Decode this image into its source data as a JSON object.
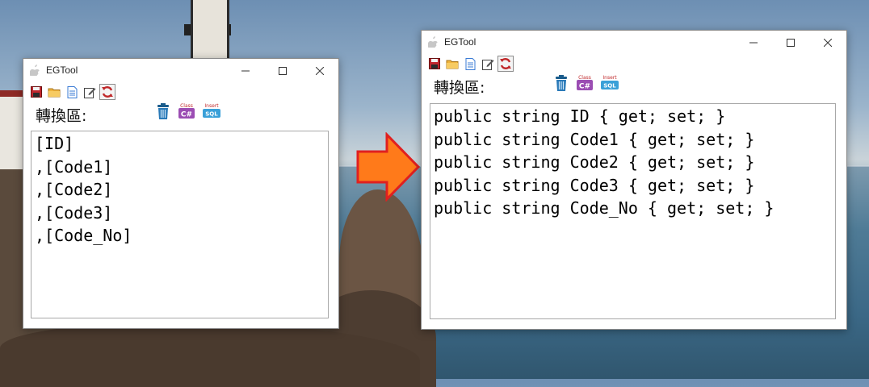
{
  "colors": {
    "arrow_fill": "#ff7a1a",
    "arrow_stroke": "#e02020",
    "titlebar": "#ffffff"
  },
  "left_window": {
    "title": "EGTool",
    "region_label": "轉換區:",
    "lines": [
      "[ID]",
      ",[Code1]",
      ",[Code2]",
      ",[Code3]",
      ",[Code_No]"
    ]
  },
  "right_window": {
    "title": "EGTool",
    "region_label": "轉換區:",
    "lines": [
      "public string ID { get; set; }",
      "public string Code1 { get; set; }",
      "public string Code2 { get; set; }",
      "public string Code3 { get; set; }",
      "public string Code_No { get; set; }"
    ]
  },
  "toolbar_icons": [
    "save-icon",
    "open-folder-icon",
    "new-document-icon",
    "edit-icon",
    "refresh-icon"
  ],
  "action_icons": {
    "trash": "trash-icon",
    "class_csharp": {
      "top": "Class",
      "bottom": "C#"
    },
    "insert_sql": {
      "top": "Insert",
      "bottom": "SQL"
    }
  }
}
